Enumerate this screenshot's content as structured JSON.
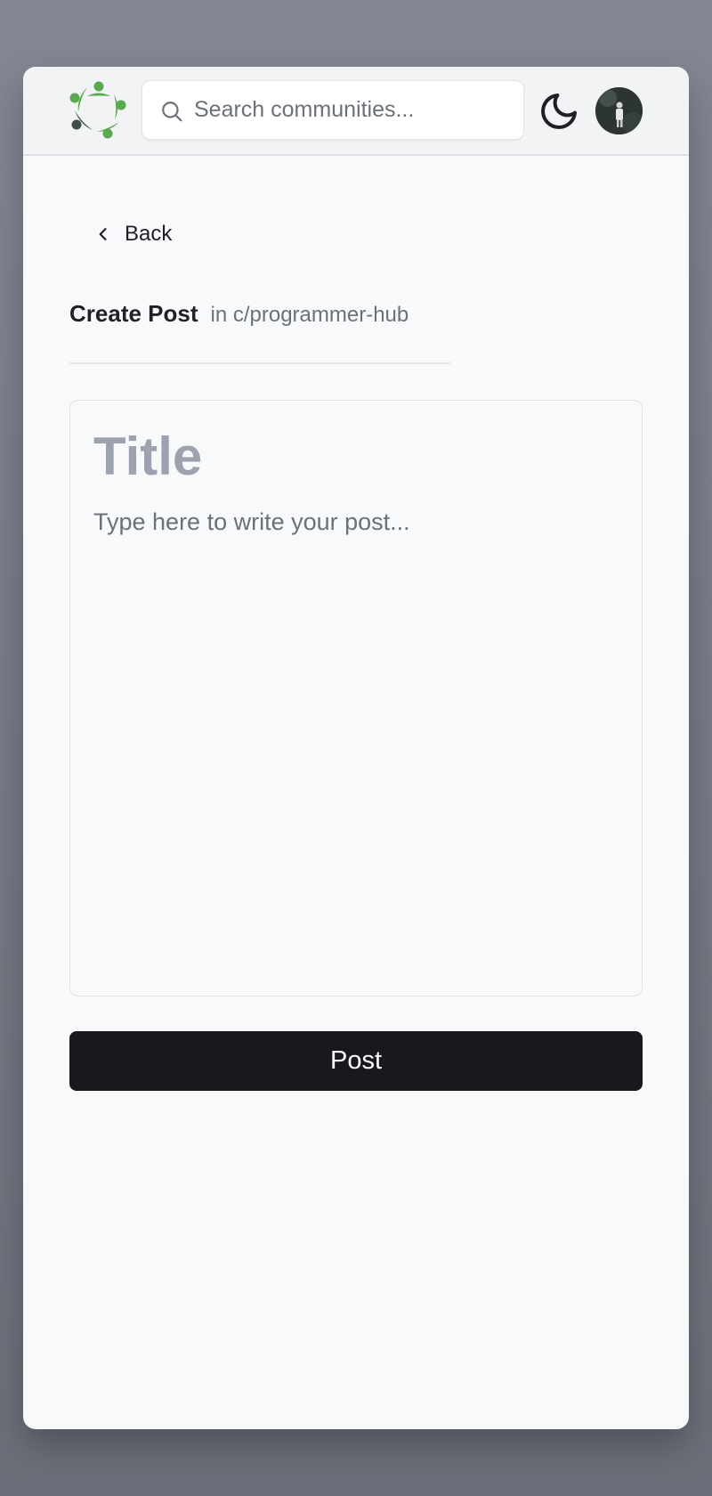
{
  "header": {
    "search": {
      "placeholder": "Search communities..."
    },
    "icons": {
      "logo": "community-logo",
      "search": "search-icon",
      "theme": "moon-icon",
      "avatar": "user-avatar"
    },
    "colors": {
      "logo_primary": "#5aa84f",
      "logo_dark": "#3f4f45"
    }
  },
  "nav": {
    "back_label": "Back",
    "back_icon": "chevron-left-icon"
  },
  "page": {
    "title": "Create Post",
    "community": "in c/programmer-hub"
  },
  "editor": {
    "title_placeholder": "Title",
    "body_placeholder": "Type here to write your post..."
  },
  "actions": {
    "post_label": "Post"
  },
  "colors": {
    "accent": "#18191d",
    "background": "#f8f9fb"
  }
}
